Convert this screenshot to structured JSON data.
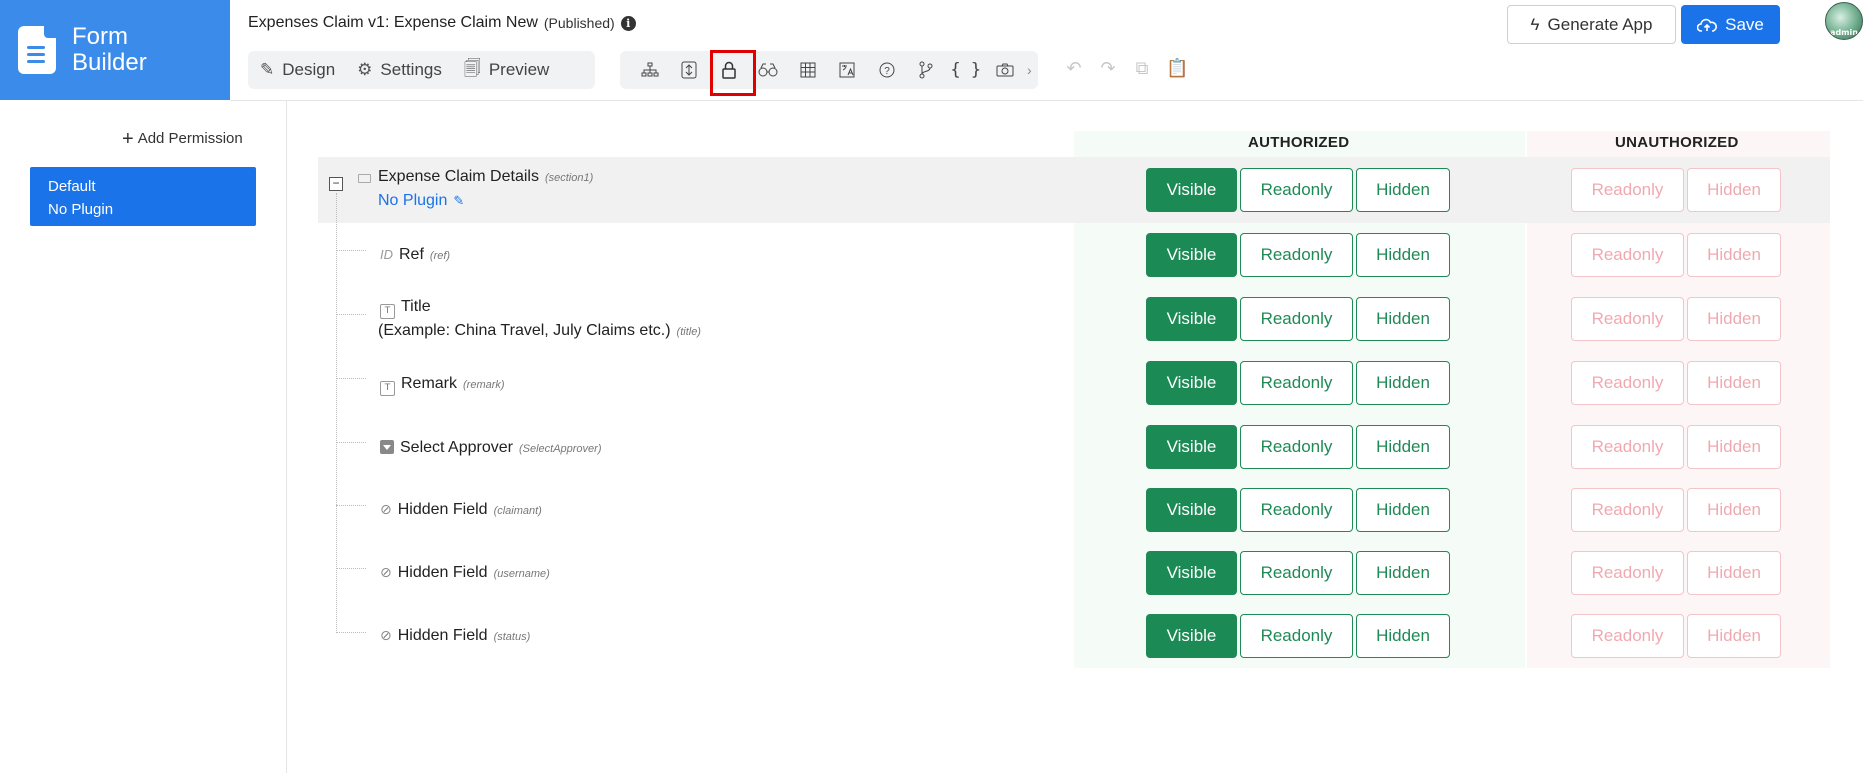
{
  "brand": {
    "line1": "Form",
    "line2": "Builder"
  },
  "header": {
    "form_name": "Expenses Claim v1: Expense Claim New",
    "status": "(Published)",
    "tabs": [
      {
        "label": "Design",
        "icon": "design-tools-icon"
      },
      {
        "label": "Settings",
        "icon": "gear-icon"
      },
      {
        "label": "Preview",
        "icon": "preview-icon"
      }
    ],
    "toolbar_icons": [
      "tree-icon",
      "properties-icon",
      "lock-icon",
      "binoculars-icon",
      "grid-icon",
      "translate-icon",
      "help-icon",
      "branch-icon",
      "code-icon",
      "camera-icon"
    ],
    "active_tool": "lock-icon",
    "generate_label": "Generate App",
    "save_label": "Save",
    "avatar_text": "admin"
  },
  "sidebar": {
    "add_permission": "Add Permission",
    "permission": {
      "name": "Default",
      "plugin": "No Plugin"
    }
  },
  "columns": {
    "authorized": "AUTHORIZED",
    "unauthorized": "UNAUTHORIZED"
  },
  "buttons": {
    "visible": "Visible",
    "readonly": "Readonly",
    "hidden": "Hidden"
  },
  "section": {
    "label": "Expense Claim Details",
    "key": "(section1)",
    "plugin_link": "No Plugin"
  },
  "fields": [
    {
      "label": "Ref",
      "key": "(ref)",
      "type": "id",
      "icon_text": "ID"
    },
    {
      "label": "Title",
      "label2": "(Example: China Travel, July Claims etc.)",
      "key": "(title)",
      "type": "text",
      "icon_text": "T"
    },
    {
      "label": "Remark",
      "key": "(remark)",
      "type": "text",
      "icon_text": "T"
    },
    {
      "label": "Select Approver",
      "key": "(SelectApprover)",
      "type": "select"
    },
    {
      "label": "Hidden Field",
      "key": "(claimant)",
      "type": "hidden"
    },
    {
      "label": "Hidden Field",
      "key": "(username)",
      "type": "hidden"
    },
    {
      "label": "Hidden Field",
      "key": "(status)",
      "type": "hidden"
    }
  ],
  "colors": {
    "brand": "#3b8beb",
    "primary": "#1a73e8",
    "visible_green": "#1c8a55",
    "unauth_pink": "#f0a9b1",
    "highlight_red": "#e00000"
  }
}
